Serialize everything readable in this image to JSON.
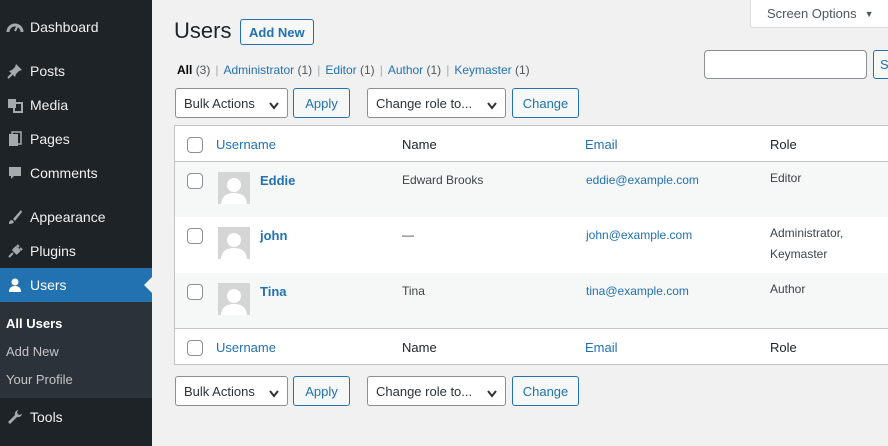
{
  "sidebar": {
    "items": [
      {
        "label": "Dashboard",
        "icon": "dashboard-icon"
      },
      {
        "label": "Posts",
        "icon": "pushpin-icon"
      },
      {
        "label": "Media",
        "icon": "media-icon"
      },
      {
        "label": "Pages",
        "icon": "pages-icon"
      },
      {
        "label": "Comments",
        "icon": "comment-icon"
      },
      {
        "label": "Appearance",
        "icon": "paintbrush-icon"
      },
      {
        "label": "Plugins",
        "icon": "plug-icon"
      },
      {
        "label": "Users",
        "icon": "user-icon"
      },
      {
        "label": "Tools",
        "icon": "wrench-icon"
      }
    ],
    "submenu": [
      "All Users",
      "Add New",
      "Your Profile"
    ]
  },
  "screen_options": "Screen Options",
  "page": {
    "title": "Users",
    "add_new": "Add New"
  },
  "filters": {
    "all": {
      "label": "All",
      "count": "(3)"
    },
    "items": [
      {
        "label": "Administrator",
        "count": "(1)"
      },
      {
        "label": "Editor",
        "count": "(1)"
      },
      {
        "label": "Author",
        "count": "(1)"
      },
      {
        "label": "Keymaster",
        "count": "(1)"
      }
    ]
  },
  "search": {
    "button": "S",
    "value": ""
  },
  "actions": {
    "bulk": "Bulk Actions",
    "apply": "Apply",
    "role": "Change role to...",
    "change": "Change"
  },
  "table": {
    "columns": [
      "Username",
      "Name",
      "Email",
      "Role"
    ],
    "rows": [
      {
        "username": "Eddie",
        "name": "Edward Brooks",
        "email": "eddie@example.com",
        "role1": "Editor",
        "role2": ""
      },
      {
        "username": "john",
        "name": "—",
        "email": "john@example.com",
        "role1": "Administrator,",
        "role2": "Keymaster"
      },
      {
        "username": "Tina",
        "name": "Tina",
        "email": "tina@example.com",
        "role1": "Author",
        "role2": ""
      }
    ]
  },
  "colors": {
    "sidebar_bg": "#1d2327",
    "accent": "#2271b1",
    "background": "#f1f1f1"
  }
}
